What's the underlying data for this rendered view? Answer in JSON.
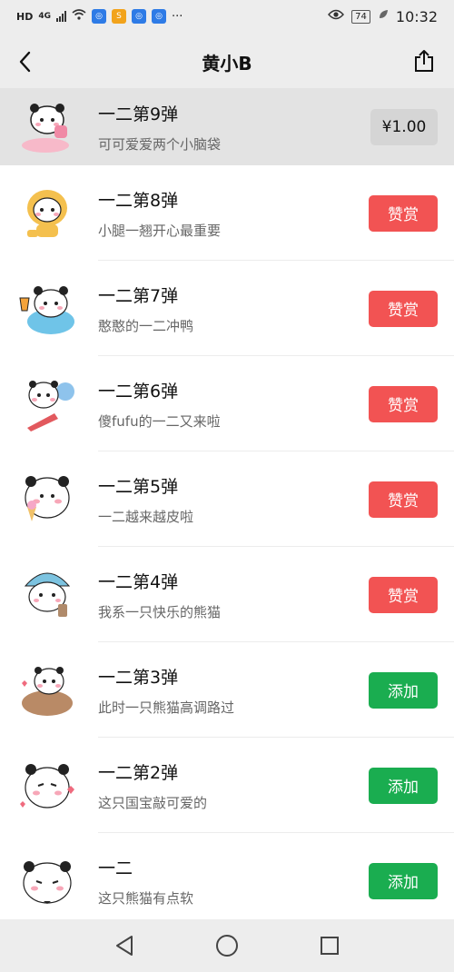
{
  "status": {
    "left_chip": "HD",
    "signal_chip": "4G",
    "dots": "···",
    "battery": "74",
    "time": "10:32"
  },
  "header": {
    "title": "黄小B"
  },
  "colors": {
    "reward": "#f25353",
    "add": "#1aad50",
    "price_bg": "#d5d5d5"
  },
  "items": [
    {
      "name": "一二第9弹",
      "desc": "可可爱爱两个小脑袋",
      "button": "¥1.00",
      "type": "price"
    },
    {
      "name": "一二第8弹",
      "desc": "小腿一翘开心最重要",
      "button": "赞赏",
      "type": "reward"
    },
    {
      "name": "一二第7弹",
      "desc": "憨憨的一二冲鸭",
      "button": "赞赏",
      "type": "reward"
    },
    {
      "name": "一二第6弹",
      "desc": "傻fufu的一二又来啦",
      "button": "赞赏",
      "type": "reward"
    },
    {
      "name": "一二第5弹",
      "desc": "一二越来越皮啦",
      "button": "赞赏",
      "type": "reward"
    },
    {
      "name": "一二第4弹",
      "desc": "我系一只快乐的熊猫",
      "button": "赞赏",
      "type": "reward"
    },
    {
      "name": "一二第3弹",
      "desc": "此时一只熊猫高调路过",
      "button": "添加",
      "type": "add"
    },
    {
      "name": "一二第2弹",
      "desc": "这只国宝敲可爱的",
      "button": "添加",
      "type": "add"
    },
    {
      "name": "一二",
      "desc": "这只熊猫有点软",
      "button": "添加",
      "type": "add"
    }
  ]
}
